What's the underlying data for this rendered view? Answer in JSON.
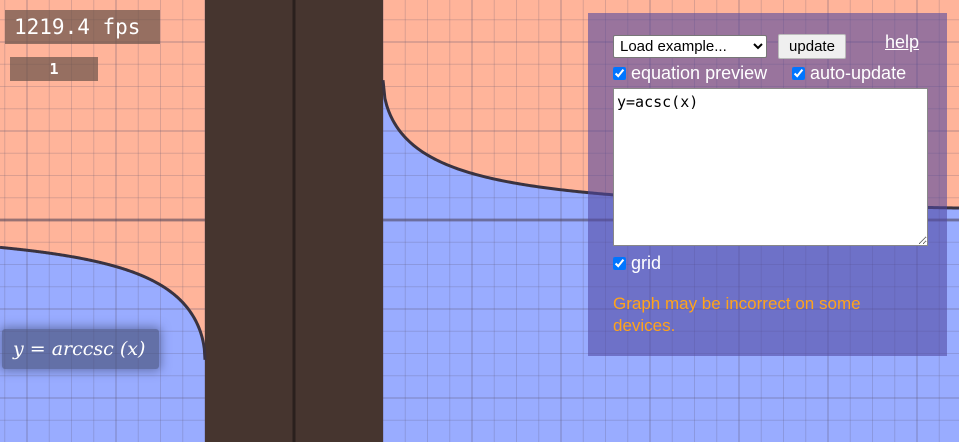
{
  "fps": {
    "value": "1219.4 fps",
    "secondary": "1"
  },
  "equation_label": {
    "text": "y = arccsc (x)"
  },
  "controls": {
    "examples_select": {
      "selected": "Load example..."
    },
    "update_label": "update",
    "help_label": "help",
    "equation_preview": {
      "label": "equation preview",
      "checked": true
    },
    "auto_update": {
      "label": "auto-update",
      "checked": true
    },
    "equation_input": {
      "value": "y=acsc(x)"
    },
    "grid": {
      "label": "grid",
      "checked": true
    },
    "warning": "Graph may be incorrect on some devices."
  },
  "colors": {
    "region_above": "#ffb49a",
    "region_below": "#99acff",
    "undefined_band": "#46352f",
    "curve": "#3a3340",
    "warning": "#ffa31a"
  },
  "graph": {
    "function": "y=acsc(x)",
    "domain_gap": [
      -1,
      1
    ],
    "grid": true
  }
}
